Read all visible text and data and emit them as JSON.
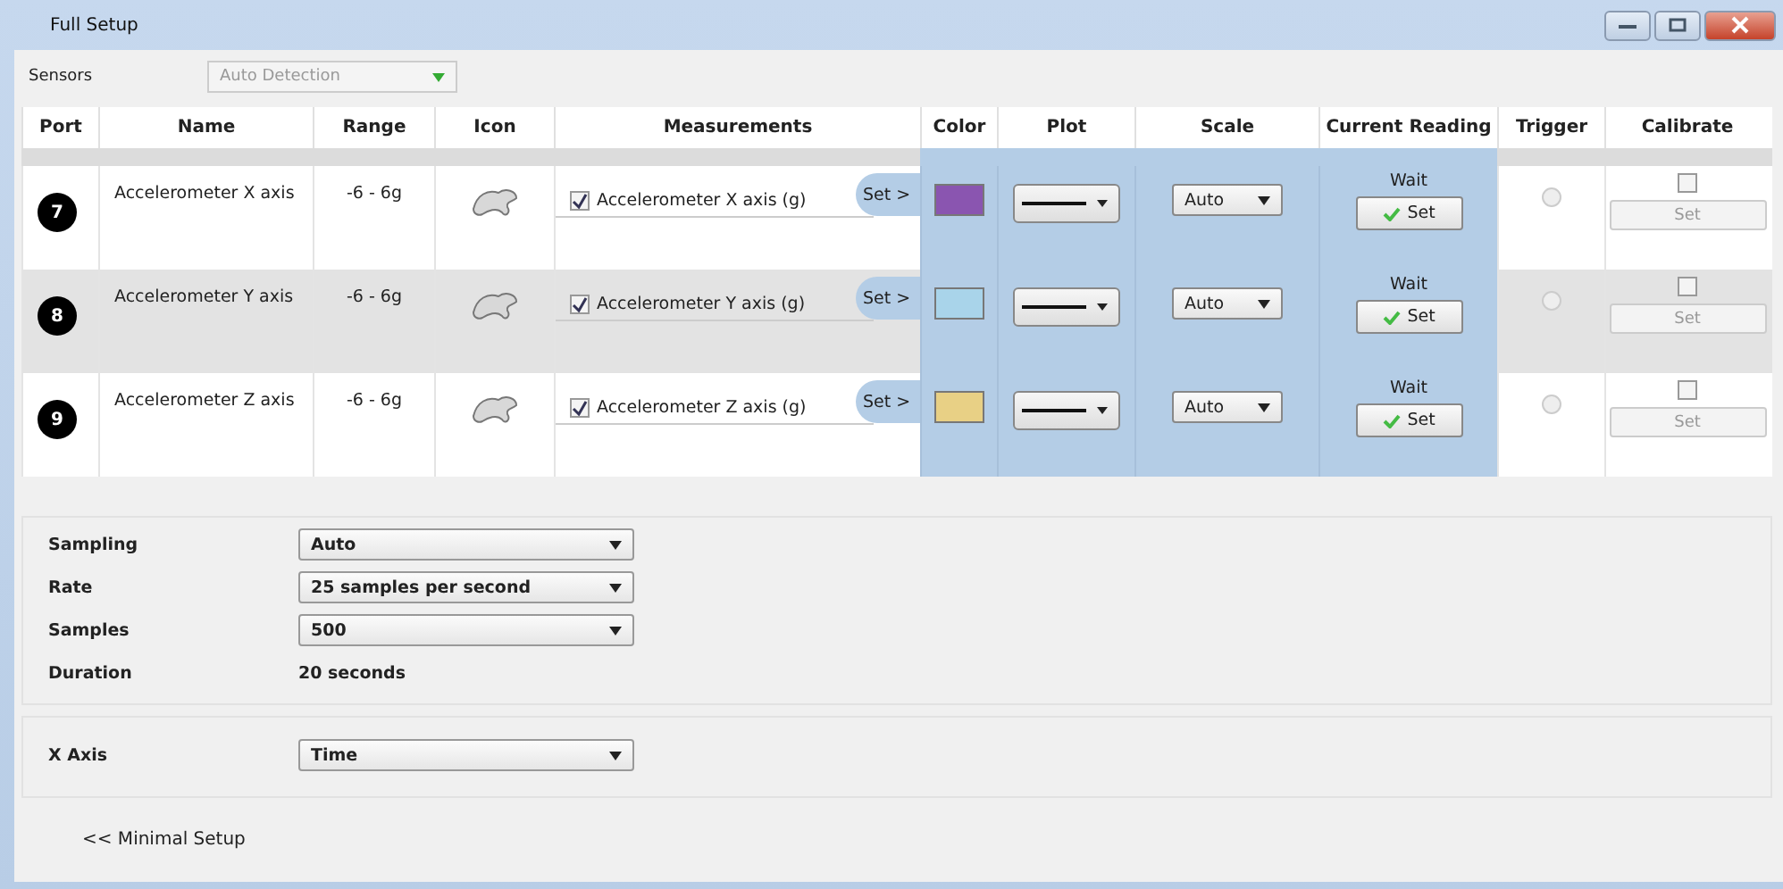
{
  "window": {
    "title": "Full Setup"
  },
  "sensors": {
    "label": "Sensors",
    "value": "Auto Detection"
  },
  "table": {
    "columns": [
      "Port",
      "Name",
      "Range",
      "Icon",
      "Measurements",
      "Color",
      "Plot",
      "Scale",
      "Current Reading",
      "Trigger",
      "Calibrate"
    ],
    "rows": [
      {
        "port": "7",
        "name": "Accelerometer X axis",
        "range": "-6 - 6g",
        "measurement": "Accelerometer X axis (g)",
        "measurement_checked": true,
        "set_label": "Set >",
        "color": "#8a55b0",
        "scale": "Auto",
        "reading": "Wait",
        "reading_button": "Set",
        "trigger_selected": false,
        "calibrate_checked": false,
        "calibrate_button": "Set",
        "highlighted": false
      },
      {
        "port": "8",
        "name": "Accelerometer Y axis",
        "range": "-6 - 6g",
        "measurement": "Accelerometer Y axis (g)",
        "measurement_checked": true,
        "set_label": "Set >",
        "color": "#a9d4ea",
        "scale": "Auto",
        "reading": "Wait",
        "reading_button": "Set",
        "trigger_selected": false,
        "calibrate_checked": false,
        "calibrate_button": "Set",
        "highlighted": true
      },
      {
        "port": "9",
        "name": "Accelerometer Z axis",
        "range": "-6 - 6g",
        "measurement": "Accelerometer Z axis (g)",
        "measurement_checked": true,
        "set_label": "Set >",
        "color": "#e8d085",
        "scale": "Auto",
        "reading": "Wait",
        "reading_button": "Set",
        "trigger_selected": false,
        "calibrate_checked": false,
        "calibrate_button": "Set",
        "highlighted": false
      }
    ]
  },
  "sampling": [
    {
      "kind": "select",
      "label": "Sampling",
      "value": "Auto"
    },
    {
      "kind": "select",
      "label": "Rate",
      "value": "25 samples per second"
    },
    {
      "kind": "select",
      "label": "Samples",
      "value": "500"
    },
    {
      "kind": "text",
      "label": "Duration",
      "value": "20 seconds"
    }
  ],
  "x_axis": {
    "label": "X Axis",
    "value": "Time"
  },
  "footer_link": "<< Minimal Setup"
}
